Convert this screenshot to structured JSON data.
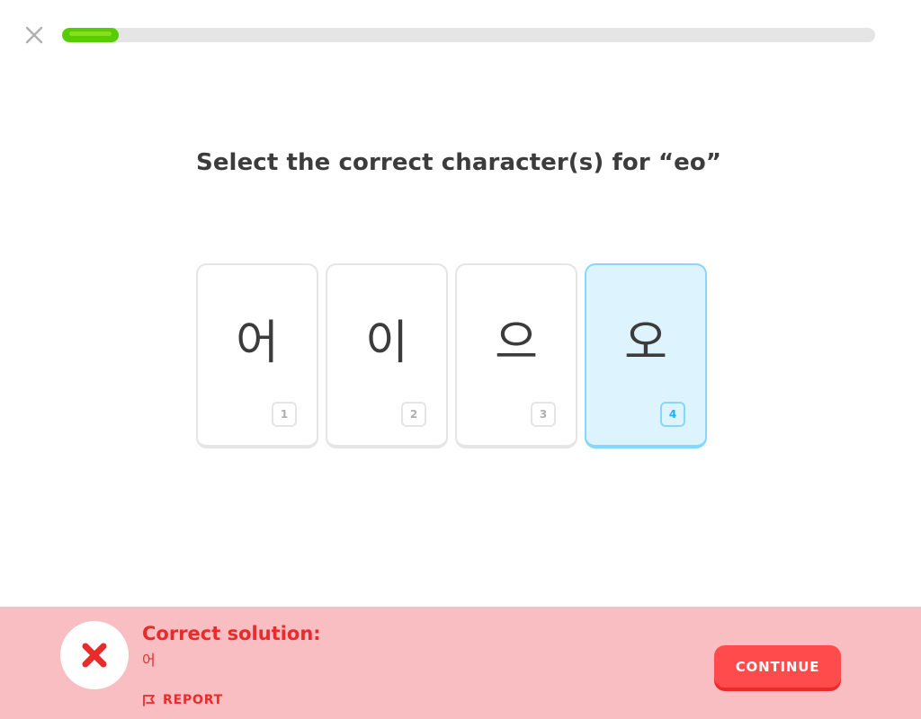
{
  "header": {
    "close_icon": "close-icon",
    "progress": {
      "value": 0.07,
      "color": "#58cc02",
      "track_color": "#e5e5e5"
    }
  },
  "prompt": "Select the correct character(s) for “eo”",
  "choices": [
    {
      "char": "어",
      "number": "1",
      "selected": false
    },
    {
      "char": "이",
      "number": "2",
      "selected": false
    },
    {
      "char": "으",
      "number": "3",
      "selected": false
    },
    {
      "char": "오",
      "number": "4",
      "selected": true
    }
  ],
  "footer": {
    "status": "incorrect",
    "status_icon": "x-icon",
    "solution_title": "Correct solution:",
    "solution_value": "어",
    "report_label": "REPORT",
    "report_icon": "flag-icon",
    "continue_label": "CONTINUE",
    "colors": {
      "background": "#f8bec1",
      "accent": "#ea2b2b",
      "button": "#ff4b4b"
    }
  }
}
